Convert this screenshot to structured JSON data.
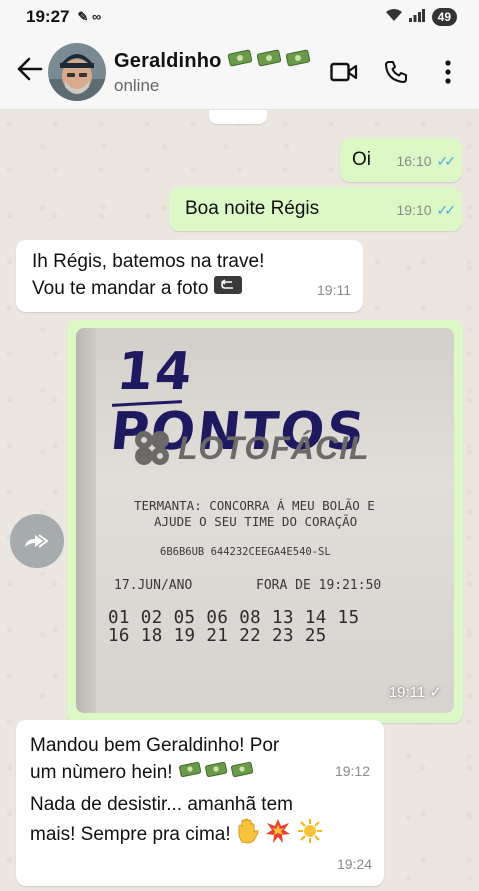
{
  "status_bar": {
    "time": "19:27",
    "battery": "49"
  },
  "header": {
    "contact_name": "Geraldinho",
    "status": "online"
  },
  "messages": {
    "m1": {
      "text": "Oi",
      "time": "16:10"
    },
    "m2": {
      "text": "Boa noite Régis",
      "time": "19:10"
    },
    "m3": {
      "line1": "Ih Régis, batemos na trave!",
      "line2": "Vou te mandar a foto",
      "time": "19:11"
    },
    "photo": {
      "time": "19:11",
      "handwritten": "14 PONTOS",
      "logo": "LOTOFÁCIL",
      "ticket_line1": "TERMANTA: CONCORRA Á MEU BOLÃO E",
      "ticket_line2": "AJUDE O SEU TIME DO CORAÇÃO",
      "ticket_code": "6B6B6UB 644232CEEGA4E540-SL",
      "ticket_date": "17.JUN/ANO",
      "ticket_fora": "FORA DE 19:21:50",
      "numbers_row1": "01 02 05 06 08 13 14 15",
      "numbers_row2": "16 18 19 21 22 23 25"
    },
    "m4": {
      "line1": "Mandou bem Geraldinho! Por",
      "line2": "um nùmero hein!",
      "time1": "19:12",
      "line3": "Nada de desistir... amanhã tem",
      "line4": "mais! Sempre pra cima!",
      "time2": "19:24"
    }
  },
  "colors": {
    "outgoing": "#dcf8c6",
    "incoming": "#ffffff",
    "read_ticks": "#4fa8e0"
  },
  "icons": [
    "arrow-back-icon",
    "video-call-icon",
    "phone-icon",
    "more-vert-icon",
    "money-emoji",
    "forward-icon",
    "hand-emoji",
    "explosion-emoji",
    "sun-emoji"
  ]
}
